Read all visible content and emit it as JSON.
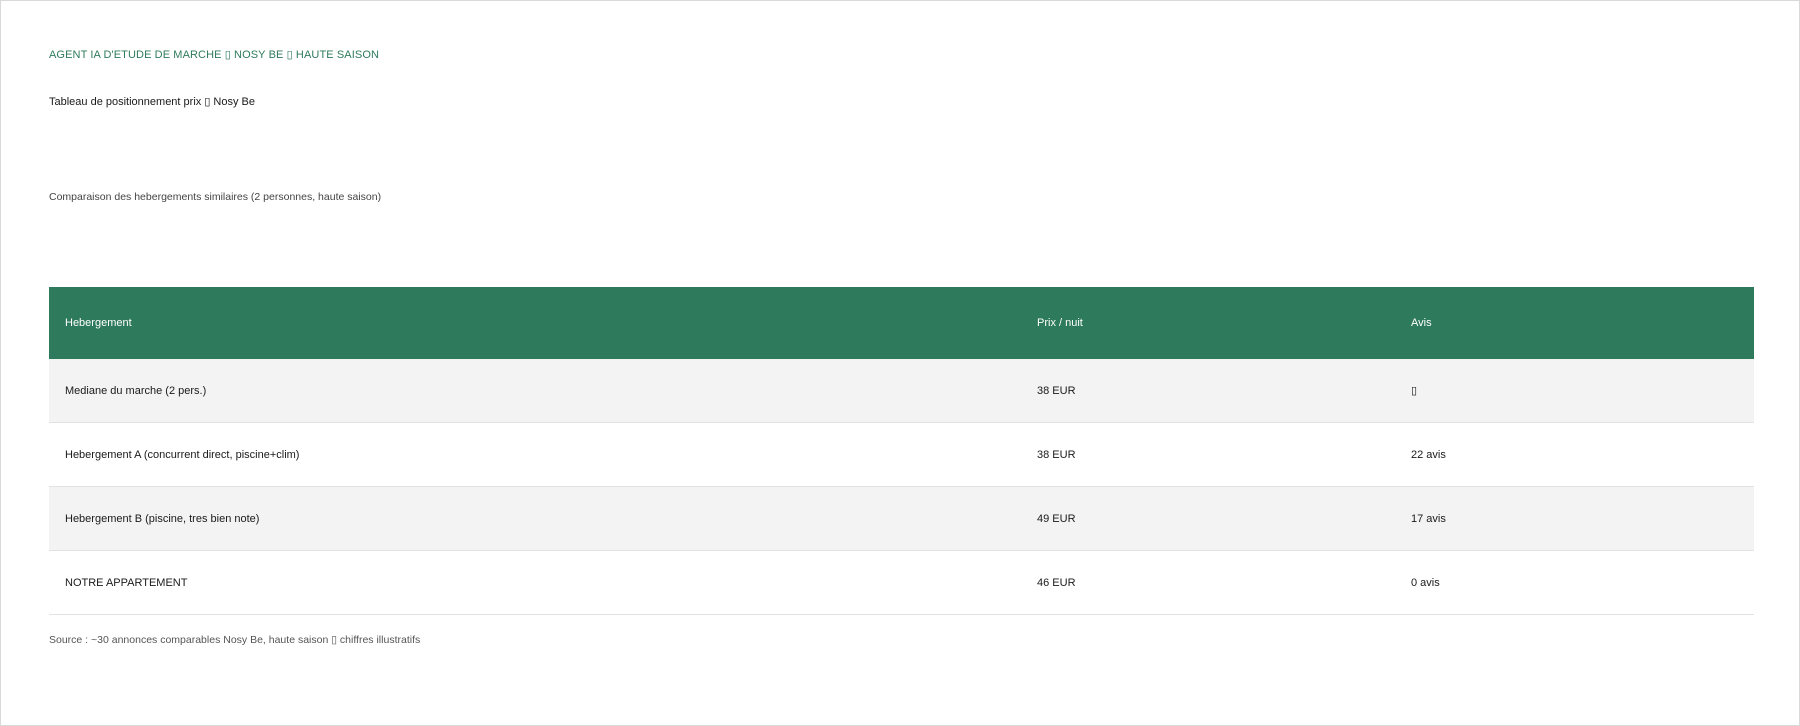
{
  "header": {
    "eyebrow": "AGENT IA D'ETUDE DE MARCHE ▯ NOSY BE ▯ HAUTE SAISON",
    "title": "Tableau de positionnement prix ▯ Nosy Be",
    "subtitle": "Comparaison des hebergements similaires (2 personnes, haute saison)"
  },
  "colors": {
    "accent": "#2e7a5c",
    "row_alt": "#f3f3f3"
  },
  "table": {
    "columns": [
      "Hebergement",
      "Prix / nuit",
      "Avis"
    ],
    "rows": [
      [
        "Mediane du marche (2 pers.)",
        "38 EUR",
        "▯"
      ],
      [
        "Hebergement A (concurrent direct, piscine+clim)",
        "38 EUR",
        "22 avis"
      ],
      [
        "Hebergement B (piscine, tres bien note)",
        "49 EUR",
        "17 avis"
      ],
      [
        "NOTRE APPARTEMENT",
        "46 EUR",
        "0 avis"
      ]
    ]
  },
  "footer": {
    "source": "Source : ~30 annonces comparables Nosy Be, haute saison ▯ chiffres illustratifs"
  }
}
